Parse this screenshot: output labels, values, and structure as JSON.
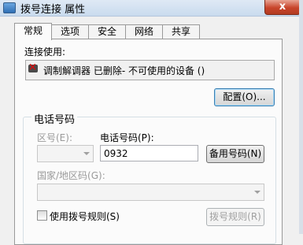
{
  "window": {
    "title": "拨号连接 属性",
    "close_label": "x"
  },
  "tabs": [
    "常规",
    "选项",
    "安全",
    "网络",
    "共享"
  ],
  "general": {
    "connect_using_label": "连接使用:",
    "device_text": "调制解调器 已删除- 不可使用的设备 ()",
    "configure_button": "配置(O)..."
  },
  "phone": {
    "group_title": "电话号码",
    "area_code_label": "区号(E):",
    "area_code_value": "",
    "phone_number_label": "电话号码(P):",
    "phone_number_value": "0932",
    "alternates_button": "备用号码(N)",
    "country_label": "国家/地区码(G):",
    "country_value": "",
    "use_dialing_rules_label": "使用拨号规则(S)",
    "use_dialing_rules_checked": false,
    "dialing_rules_button": "拨号规则(R)"
  }
}
